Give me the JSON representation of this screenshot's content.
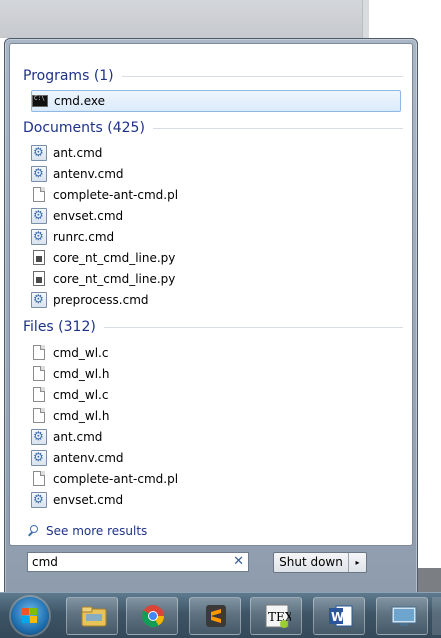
{
  "groups": [
    {
      "title": "Programs (1)",
      "items": [
        {
          "label": "cmd.exe",
          "icon": "cmd-icon"
        }
      ]
    },
    {
      "title": "Documents (425)",
      "items": [
        {
          "label": "ant.cmd",
          "icon": "batch-file-icon"
        },
        {
          "label": "antenv.cmd",
          "icon": "batch-file-icon"
        },
        {
          "label": "complete-ant-cmd.pl",
          "icon": "text-file-icon"
        },
        {
          "label": "envset.cmd",
          "icon": "batch-file-icon"
        },
        {
          "label": "runrc.cmd",
          "icon": "batch-file-icon"
        },
        {
          "label": "core_nt_cmd_line.py",
          "icon": "python-file-icon"
        },
        {
          "label": "core_nt_cmd_line.py",
          "icon": "python-file-icon"
        },
        {
          "label": "preprocess.cmd",
          "icon": "batch-file-icon"
        }
      ]
    },
    {
      "title": "Files (312)",
      "items": [
        {
          "label": "cmd_wl.c",
          "icon": "text-file-icon"
        },
        {
          "label": "cmd_wl.h",
          "icon": "text-file-icon"
        },
        {
          "label": "cmd_wl.c",
          "icon": "text-file-icon"
        },
        {
          "label": "cmd_wl.h",
          "icon": "text-file-icon"
        },
        {
          "label": "ant.cmd",
          "icon": "batch-file-icon"
        },
        {
          "label": "antenv.cmd",
          "icon": "batch-file-icon"
        },
        {
          "label": "complete-ant-cmd.pl",
          "icon": "text-file-icon"
        },
        {
          "label": "envset.cmd",
          "icon": "batch-file-icon"
        }
      ]
    }
  ],
  "see_more": "See more results",
  "search": {
    "value": "cmd",
    "clear_icon": "clear-icon"
  },
  "shutdown": {
    "label": "Shut down",
    "arrow": "▸"
  },
  "taskbar": {
    "apps": [
      {
        "name": "windows-explorer",
        "icon": "folder-icon"
      },
      {
        "name": "google-chrome",
        "icon": "chrome-icon"
      },
      {
        "name": "sublime-text",
        "icon": "sublime-icon"
      },
      {
        "name": "texworks",
        "icon": "tex-icon",
        "icon_text": "TEX"
      },
      {
        "name": "microsoft-word",
        "icon": "word-icon",
        "icon_text": "W"
      },
      {
        "name": "remote-desktop",
        "icon": "remote-desktop-icon"
      }
    ]
  },
  "colors": {
    "group_title": "#1e3287",
    "selection": "#dcebfc",
    "taskbar": "#3e5566"
  }
}
